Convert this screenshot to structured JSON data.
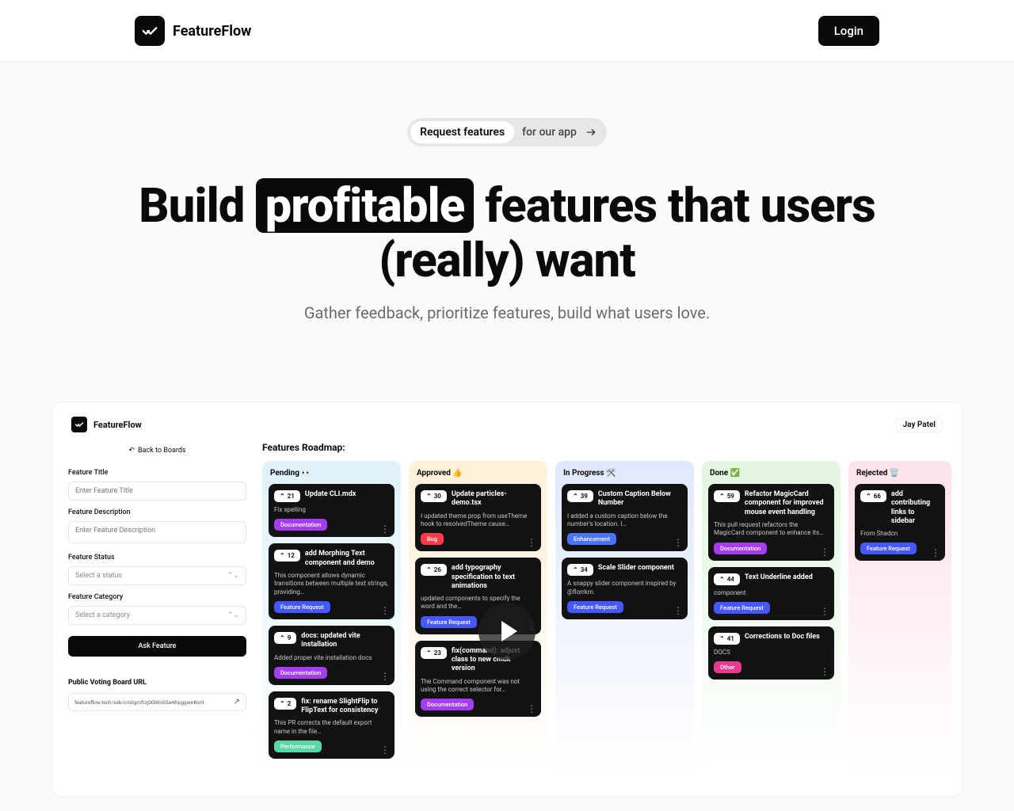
{
  "brand": "FeatureFlow",
  "header": {
    "login": "Login"
  },
  "hero": {
    "pill_badge": "Request features",
    "pill_text": "for our app",
    "headline_pre": "Build ",
    "headline_highlight": "profitable",
    "headline_post": " features that users (really) want",
    "subhead": "Gather feedback, prioritize features, build what users love."
  },
  "preview": {
    "brand": "FeatureFlow",
    "user": "Jay Patel",
    "sidebar": {
      "back": "Back to Boards",
      "title_label": "Feature Title",
      "title_ph": "Enter Feature Title",
      "desc_label": "Feature Description",
      "desc_ph": "Enter Feature Description",
      "status_label": "Feature Status",
      "status_ph": "Select a status",
      "cat_label": "Feature Category",
      "cat_ph": "Select a category",
      "ask_btn": "Ask Feature",
      "url_label": "Public Voting Board URL",
      "url_value": "featureflow.tech/ssk/cm0gmfrzj0006v65a4ihpggwe#orit"
    },
    "board_title": "Features Roadmap:",
    "tag_colors": {
      "Documentation": "#a43cf0",
      "Feature Request": "#4558ff",
      "Bug": "#ff3b4a",
      "Enhancement": "#4a73ff",
      "Performance": "#58d7a9",
      "Other": "#e63990"
    },
    "columns": [
      {
        "name": "Pending 👀",
        "bg": "bg-pending",
        "cards": [
          {
            "votes": 21,
            "title": "Update CLI.mdx",
            "desc": "Fix spelling",
            "tag": "Documentation"
          },
          {
            "votes": 12,
            "title": "add Morphing Text component and demo",
            "desc": "This component allows dynamic transitions between multiple text strings, providing…",
            "tag": "Feature Request"
          },
          {
            "votes": 9,
            "title": "docs: updated vite installation",
            "desc": "Added proper vite installation docs",
            "tag": "Documentation"
          },
          {
            "votes": 2,
            "title": "fix: rename SlightFlip to FlipText for consistency",
            "desc": "This PR corrects the default export name in the file…",
            "tag": "Performance"
          }
        ]
      },
      {
        "name": "Approved 👍",
        "bg": "bg-approved",
        "cards": [
          {
            "votes": 30,
            "title": "Update particles-demo.tsx",
            "desc": "I updated theme prop from useTheme hook to resolvedTheme cause…",
            "tag": "Bug"
          },
          {
            "votes": 26,
            "title": "add typography specification to text animations",
            "desc": "updated components to specify the word and the…",
            "tag": "Feature Request"
          },
          {
            "votes": 23,
            "title": "fix(command): adjust class to new cmdk version",
            "desc": "The Command component was not using the correct selector for…",
            "tag": "Documentation"
          }
        ]
      },
      {
        "name": "In Progress 🛠️",
        "bg": "bg-progress",
        "cards": [
          {
            "votes": 39,
            "title": "Custom Caption Below Number",
            "desc": "I added a custom caption below the number's location. I…",
            "tag": "Enhancement"
          },
          {
            "votes": 34,
            "title": "Scale Slider component",
            "desc": "A snappy slider component inspired by @florrkm.",
            "tag": "Feature Request"
          }
        ]
      },
      {
        "name": "Done ✅",
        "bg": "bg-done",
        "cards": [
          {
            "votes": 59,
            "title": "Refactor MagicCard component for improved mouse event handling",
            "desc": "This pull request refactors the MagicCard component to enhance its…",
            "tag": "Documentation"
          },
          {
            "votes": 44,
            "title": "Text Underline added",
            "desc": "component",
            "tag": "Feature Request"
          },
          {
            "votes": 41,
            "title": "Corrections to Doc files",
            "desc": "DOCS",
            "tag": "Other"
          }
        ]
      },
      {
        "name": "Rejected 🗑️",
        "bg": "bg-rejected",
        "cards": [
          {
            "votes": 66,
            "title": "add contributing links to sidebar",
            "desc": "From Shadcn",
            "tag": "Feature Request"
          }
        ]
      }
    ]
  }
}
